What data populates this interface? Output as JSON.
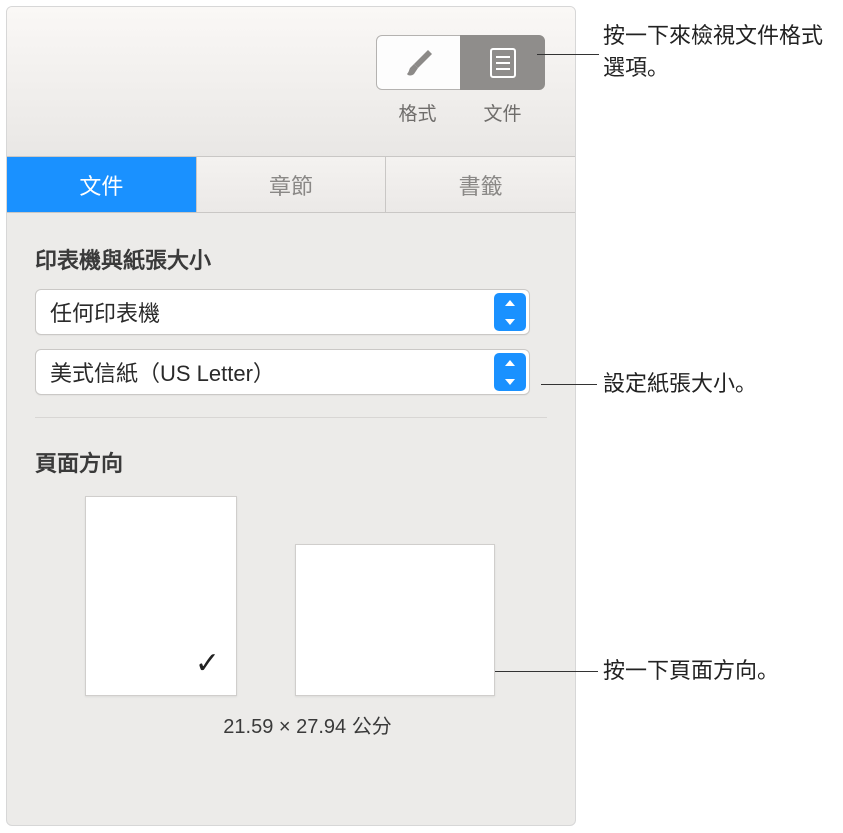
{
  "toolbar": {
    "format_label": "格式",
    "document_label": "文件"
  },
  "tabs": {
    "document": "文件",
    "sections": "章節",
    "bookmarks": "書籤"
  },
  "printer_section": {
    "title": "印表機與紙張大小",
    "printer_value": "任何印表機",
    "paper_value": "美式信紙（US Letter）"
  },
  "orientation_section": {
    "title": "頁面方向",
    "dimensions": "21.59 × 27.94 公分"
  },
  "callouts": {
    "doc_button": "按一下來檢視文件格式選項。",
    "paper_size": "設定紙張大小。",
    "orientation": "按一下頁面方向。"
  }
}
